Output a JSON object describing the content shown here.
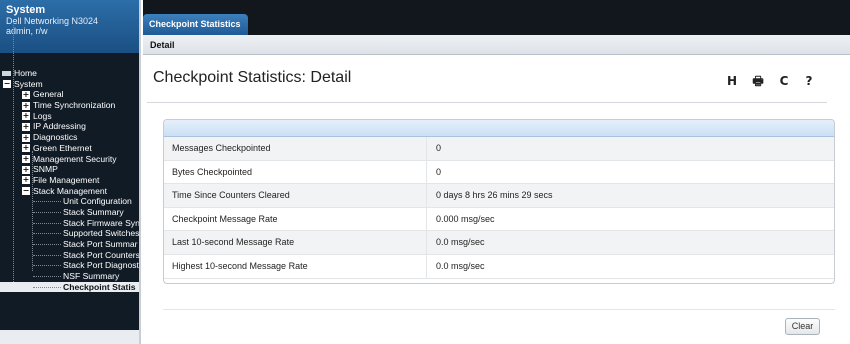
{
  "sidebar": {
    "title": "System",
    "model": "Dell Networking N3024",
    "user": "admin, r/w",
    "tree": [
      {
        "label": "Home",
        "expander": ""
      },
      {
        "label": "System",
        "expander": "−"
      },
      {
        "label": "General",
        "expander": "+"
      },
      {
        "label": "Time Synchronization",
        "expander": "+"
      },
      {
        "label": "Logs",
        "expander": "+"
      },
      {
        "label": "IP Addressing",
        "expander": "+"
      },
      {
        "label": "Diagnostics",
        "expander": "+"
      },
      {
        "label": "Green Ethernet",
        "expander": "+"
      },
      {
        "label": "Management Security",
        "expander": "+"
      },
      {
        "label": "SNMP",
        "expander": "+"
      },
      {
        "label": "File Management",
        "expander": "+"
      },
      {
        "label": "Stack Management",
        "expander": "−"
      },
      {
        "label": "Unit Configuration"
      },
      {
        "label": "Stack Summary"
      },
      {
        "label": "Stack Firmware Syn"
      },
      {
        "label": "Supported Switches"
      },
      {
        "label": "Stack Port Summar"
      },
      {
        "label": "Stack Port Counters"
      },
      {
        "label": "Stack Port Diagnost"
      },
      {
        "label": "NSF Summary"
      },
      {
        "label": "Checkpoint Statis"
      }
    ]
  },
  "tabs": {
    "active": "Checkpoint Statistics",
    "subtab": "Detail"
  },
  "page": {
    "title": "Checkpoint Statistics: Detail",
    "icons": {
      "help": "H",
      "print": "🖶",
      "refresh": "C",
      "question": "?"
    }
  },
  "stats": [
    {
      "key": "Messages Checkpointed",
      "value": "0"
    },
    {
      "key": "Bytes Checkpointed",
      "value": "0"
    },
    {
      "key": "Time Since Counters Cleared",
      "value": "0 days 8 hrs 26 mins 29 secs"
    },
    {
      "key": "Checkpoint Message Rate",
      "value": "0.000 msg/sec"
    },
    {
      "key": "Last 10-second Message Rate",
      "value": "0.0 msg/sec"
    },
    {
      "key": "Highest 10-second Message Rate",
      "value": "0.0 msg/sec"
    }
  ],
  "actions": {
    "clear_label": "Clear"
  }
}
